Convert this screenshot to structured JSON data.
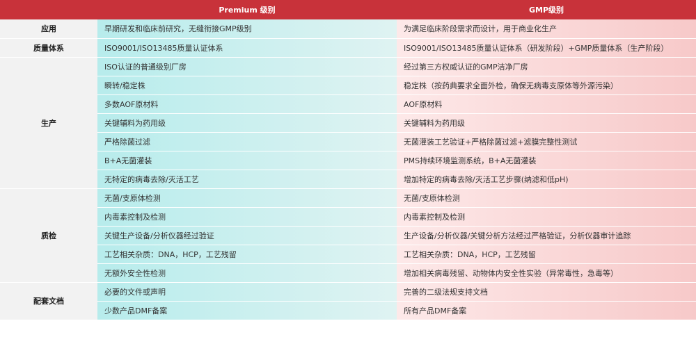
{
  "header": {
    "col0": "",
    "premium": "Premium 级别",
    "gmp": "GMP级别"
  },
  "groups": [
    {
      "category": "应用",
      "rows": [
        {
          "premium": "早期研发和临床前研究，无缝衔接GMP级别",
          "gmp": "为满足临床阶段需求而设计，用于商业化生产"
        }
      ]
    },
    {
      "category": "质量体系",
      "rows": [
        {
          "premium": "ISO9001/ISO13485质量认证体系",
          "gmp": "ISO9001/ISO13485质量认证体系（研发阶段）+GMP质量体系（生产阶段）"
        }
      ]
    },
    {
      "category": "生产",
      "rows": [
        {
          "premium": "ISO认证的普通级别厂房",
          "gmp": "经过第三方权威认证的GMP洁净厂房"
        },
        {
          "premium": "瞬转/稳定株",
          "gmp": "稳定株（按药典要求全面外检，确保无病毒支原体等外源污染）"
        },
        {
          "premium": "多数AOF原材料",
          "gmp": "AOF原材料"
        },
        {
          "premium": "关键辅料为药用级",
          "gmp": "关键辅料为药用级"
        },
        {
          "premium": "严格除菌过滤",
          "gmp": "无菌灌装工艺验证+严格除菌过滤+滤膜完整性测试"
        },
        {
          "premium": "B+A无菌灌装",
          "gmp": "PMS持续环境监测系统，B+A无菌灌装"
        },
        {
          "premium": "无特定的病毒去除/灭活工艺",
          "gmp": "增加特定的病毒去除/灭活工艺步骤(纳滤和低pH)"
        }
      ]
    },
    {
      "category": "质检",
      "rows": [
        {
          "premium": "无菌/支原体检测",
          "gmp": "无菌/支原体检测"
        },
        {
          "premium": "内毒素控制及检测",
          "gmp": "内毒素控制及检测"
        },
        {
          "premium": "关键生产设备/分析仪器经过验证",
          "gmp": "生产设备/分析仪器/关键分析方法经过严格验证，分析仪器审计追踪"
        },
        {
          "premium": "工艺相关杂质：DNA，HCP，工艺残留",
          "gmp": "工艺相关杂质：DNA，HCP，工艺残留"
        },
        {
          "premium": "无额外安全性检测",
          "gmp": "增加相关病毒残留、动物体内安全性实验（异常毒性，急毒等）"
        }
      ]
    },
    {
      "category": "配套文档",
      "rows": [
        {
          "premium": "必要的文件或声明",
          "gmp": "完善的二级法规支持文档"
        },
        {
          "premium": "少数产品DMF备案",
          "gmp": "所有产品DMF备案"
        }
      ]
    }
  ]
}
